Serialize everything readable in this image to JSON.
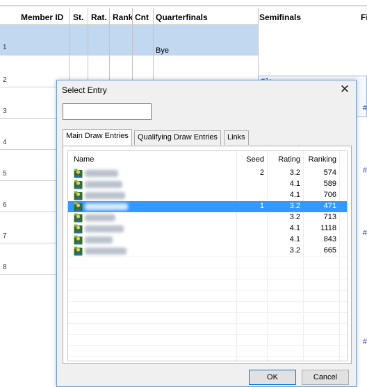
{
  "background": {
    "columns": [
      "Member ID",
      "St.",
      "Rat.",
      "Rank",
      "Cnt",
      "Quarterfinals",
      "Semifinals",
      "Fi"
    ],
    "row_numbers": [
      "1",
      "2",
      "3",
      "4",
      "5",
      "6",
      "7",
      "8"
    ],
    "bye_label": "Bye",
    "semi_match_label": "#1:",
    "edge_mark": "#"
  },
  "dialog": {
    "title": "Select Entry",
    "close_glyph": "✕",
    "search_value": "",
    "tabs": [
      {
        "label": "Main Draw Entries",
        "active": true
      },
      {
        "label": "Qualifying Draw Entries",
        "active": false
      },
      {
        "label": "Links",
        "active": false
      }
    ],
    "list_headers": {
      "name": "Name",
      "seed": "Seed",
      "rating": "Rating",
      "ranking": "Ranking"
    },
    "entries": [
      {
        "name": "Bell, Cameron",
        "seed": "2",
        "rating": "3.2",
        "ranking": "574",
        "selected": false
      },
      {
        "name": "Dyer, Christian",
        "seed": "",
        "rating": "4.1",
        "ranking": "589",
        "selected": false
      },
      {
        "name": "Margherini, William",
        "seed": "",
        "rating": "4.1",
        "ranking": "706",
        "selected": false
      },
      {
        "name": "Hawkins, Mark",
        "seed": "1",
        "rating": "3.2",
        "ranking": "471",
        "selected": true
      },
      {
        "name": "Pearce, Carl",
        "seed": "",
        "rating": "3.2",
        "ranking": "713",
        "selected": false
      },
      {
        "name": "Revelli, Giacomo",
        "seed": "",
        "rating": "4.1",
        "ranking": "1118",
        "selected": false
      },
      {
        "name": "Smith, Ben",
        "seed": "",
        "rating": "4.1",
        "ranking": "843",
        "selected": false
      },
      {
        "name": "Verzasmer, Robin",
        "seed": "",
        "rating": "3.2",
        "ranking": "665",
        "selected": false
      }
    ],
    "ok_label": "OK",
    "cancel_label": "Cancel"
  },
  "colors": {
    "selection": "#3399ff",
    "highlight_row": "#c2d7f0",
    "accent_border": "#0078d7"
  },
  "icons": {
    "entry": "person-icon",
    "close": "close-icon"
  }
}
